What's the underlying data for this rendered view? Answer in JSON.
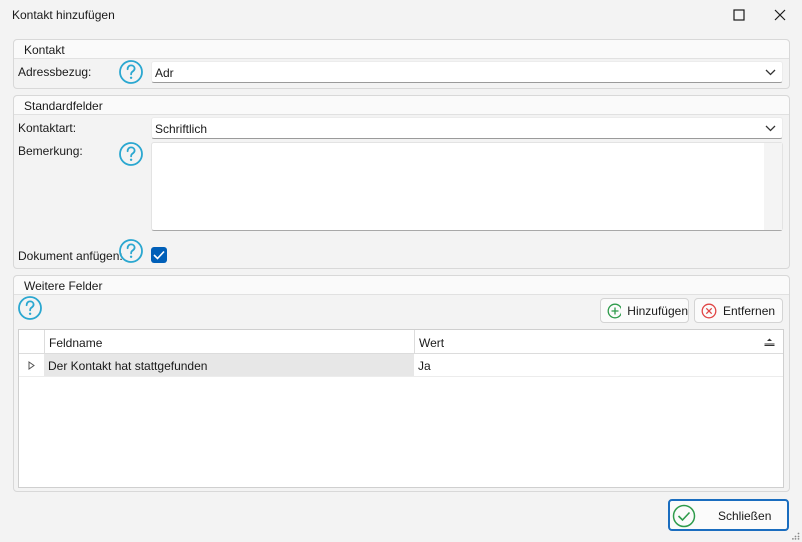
{
  "window": {
    "title": "Kontakt hinzufügen",
    "maximize_icon": "maximize-icon",
    "close_icon": "close-icon"
  },
  "kontakt_group": {
    "title": "Kontakt",
    "adressbezug_label": "Adressbezug:",
    "adressbezug_value": "Adr"
  },
  "standard_group": {
    "title": "Standardfelder",
    "kontaktart_label": "Kontaktart:",
    "kontaktart_value": "Schriftlich",
    "bemerkung_label": "Bemerkung:",
    "bemerkung_value": "",
    "dokument_label": "Dokument anfügen:",
    "dokument_checked": true
  },
  "weitere_group": {
    "title": "Weitere Felder",
    "add_label": "Hinzufügen",
    "remove_label": "Entfernen",
    "columns": [
      "Feldname",
      "Wert"
    ],
    "rows": [
      {
        "feldname": "Der Kontakt hat stattgefunden",
        "wert": "Ja"
      }
    ]
  },
  "footer": {
    "close_label": "Schließen"
  },
  "colors": {
    "accent": "#005fb8",
    "help_icon": "#2aa7d0",
    "add_icon": "#2e9b4b",
    "remove_icon": "#e04545",
    "close_check": "#2e9b4b",
    "default_border": "#1a6dbf"
  }
}
